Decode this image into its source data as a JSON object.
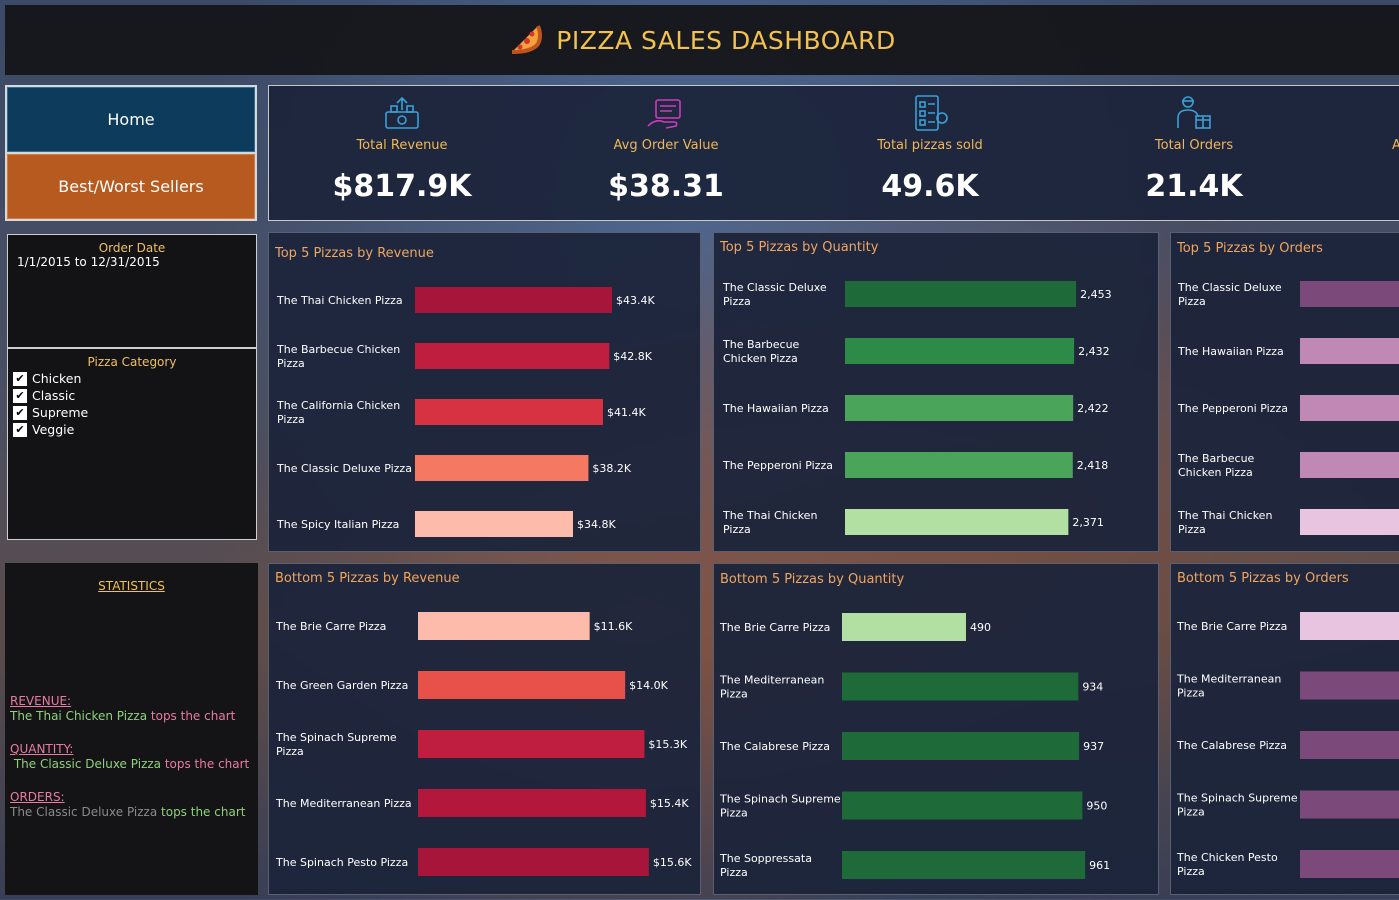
{
  "header": {
    "title": "PIZZA SALES DASHBOARD"
  },
  "nav": {
    "home_label": "Home",
    "best_worst_label": "Best/Worst Sellers"
  },
  "kpis": [
    {
      "label": "Total Revenue",
      "value": "$817.9K",
      "icon": "revenue-icon"
    },
    {
      "label": "Avg Order Value",
      "value": "$38.31",
      "icon": "order-value-icon"
    },
    {
      "label": "Total pizzas sold",
      "value": "49.6K",
      "icon": "pizzas-sold-icon"
    },
    {
      "label": "Total Orders",
      "value": "21.4K",
      "icon": "orders-icon"
    },
    {
      "label": "A",
      "value": "",
      "icon": ""
    }
  ],
  "filters": {
    "date_title": "Order Date",
    "date_value": "1/1/2015 to 12/31/2015",
    "category_title": "Pizza Category",
    "categories": [
      "Chicken",
      "Classic",
      "Supreme",
      "Veggie"
    ],
    "checkmark": "✔"
  },
  "stats": {
    "title": "STATISTICS",
    "revenue_label": "REVENUE:",
    "revenue_name": "The Thai Chicken Pizza",
    "revenue_tail": " tops the chart",
    "quantity_label": "QUANTITY:",
    "quantity_name": " The Classic Deluxe Pizza",
    "quantity_tail": " tops the chart",
    "orders_label": "ORDERS:",
    "orders_name": "The Classic Deluxe Pizza",
    "orders_tail": " tops the chart",
    "colors": {
      "label": "#e87ba0",
      "name": "#8fd17a",
      "muted": "#8a8a8a"
    }
  },
  "chart_data": [
    {
      "type": "bar",
      "title": "Top 5 Pizzas by Revenue",
      "categories": [
        [
          "The Thai Chicken Pizza"
        ],
        [
          "The Barbecue Chicken",
          "Pizza"
        ],
        [
          "The California Chicken",
          "Pizza"
        ],
        [
          "The Classic Deluxe Pizza"
        ],
        [
          "The Spicy Italian Pizza"
        ]
      ],
      "values": [
        43.4,
        42.8,
        41.4,
        38.2,
        34.8
      ],
      "labels": [
        "$43.4K",
        "$42.8K",
        "$41.4K",
        "$38.2K",
        "$34.8K"
      ],
      "colors": [
        "#a8153a",
        "#c01e3e",
        "#d63242",
        "#f47862",
        "#fdbcab"
      ],
      "xlim": [
        0,
        50
      ]
    },
    {
      "type": "bar",
      "title": "Top 5 Pizzas by Quantity",
      "categories": [
        [
          "The Classic Deluxe",
          "Pizza"
        ],
        [
          "The Barbecue",
          "Chicken Pizza"
        ],
        [
          "The Hawaiian Pizza"
        ],
        [
          "The Pepperoni Pizza"
        ],
        [
          "The Thai Chicken",
          "Pizza"
        ]
      ],
      "values": [
        2453,
        2432,
        2422,
        2418,
        2371
      ],
      "labels": [
        "2,453",
        "2,432",
        "2,422",
        "2,418",
        "2,371"
      ],
      "colors": [
        "#1e6a38",
        "#2e8a47",
        "#4aa55a",
        "#4aa55a",
        "#b2e0a2"
      ],
      "xlim": [
        0,
        2760
      ]
    },
    {
      "type": "bar",
      "title": "Top 5 Pizzas by Orders",
      "categories": [
        [
          "The Classic Deluxe",
          "Pizza"
        ],
        [
          "The Hawaiian Pizza"
        ],
        [
          "The Pepperoni Pizza"
        ],
        [
          "The Barbecue",
          "Chicken Pizza"
        ],
        [
          "The Thai Chicken",
          "Pizza"
        ]
      ],
      "values": [
        2329,
        2280,
        2278,
        2273,
        2225
      ],
      "labels": [
        "",
        "",
        "",
        "",
        ""
      ],
      "colors": [
        "#7b4a7a",
        "#c088b4",
        "#c088b4",
        "#c088b4",
        "#e8c4e0"
      ],
      "xlim": [
        0,
        2760
      ]
    },
    {
      "type": "bar",
      "title": "Bottom 5 Pizzas by Revenue",
      "categories": [
        [
          "The Brie Carre Pizza"
        ],
        [
          "The Green Garden Pizza"
        ],
        [
          "The Spinach Supreme",
          "Pizza"
        ],
        [
          "The Mediterranean Pizza"
        ],
        [
          "The Spinach Pesto Pizza"
        ]
      ],
      "values": [
        11.6,
        14.0,
        15.3,
        15.4,
        15.6
      ],
      "labels": [
        "$11.6K",
        "$14.0K",
        "$15.3K",
        "$15.4K",
        "$15.6K"
      ],
      "colors": [
        "#fdbcab",
        "#e8504a",
        "#c01e3e",
        "#b3183c",
        "#a8153a"
      ],
      "xlim": [
        0,
        17.3
      ]
    },
    {
      "type": "bar",
      "title": "Bottom 5 Pizzas by Quantity",
      "categories": [
        [
          "The Brie Carre Pizza"
        ],
        [
          "The Mediterranean",
          "Pizza"
        ],
        [
          "The Calabrese Pizza"
        ],
        [
          "The Spinach Supreme",
          "Pizza"
        ],
        [
          "The Soppressata",
          "Pizza"
        ]
      ],
      "values": [
        490,
        934,
        937,
        950,
        961
      ],
      "labels": [
        "490",
        "934",
        "937",
        "950",
        "961"
      ],
      "colors": [
        "#b2e0a2",
        "#1e6a38",
        "#1e6a38",
        "#1e6a38",
        "#1e6a38"
      ],
      "xlim": [
        0,
        1075
      ]
    },
    {
      "type": "bar",
      "title": "Bottom 5 Pizzas by Orders",
      "categories": [
        [
          "The Brie Carre Pizza"
        ],
        [
          "The Mediterranean",
          "Pizza"
        ],
        [
          "The Calabrese Pizza"
        ],
        [
          "The Spinach Supreme",
          "Pizza"
        ],
        [
          "The Chicken Pesto",
          "Pizza"
        ]
      ],
      "values": [
        480,
        912,
        918,
        918,
        938
      ],
      "labels": [
        "",
        "",
        "",
        "",
        ""
      ],
      "colors": [
        "#e8c4e0",
        "#7b4a7a",
        "#7b4a7a",
        "#7b4a7a",
        "#7b4a7a"
      ],
      "xlim": [
        0,
        1075
      ]
    }
  ]
}
